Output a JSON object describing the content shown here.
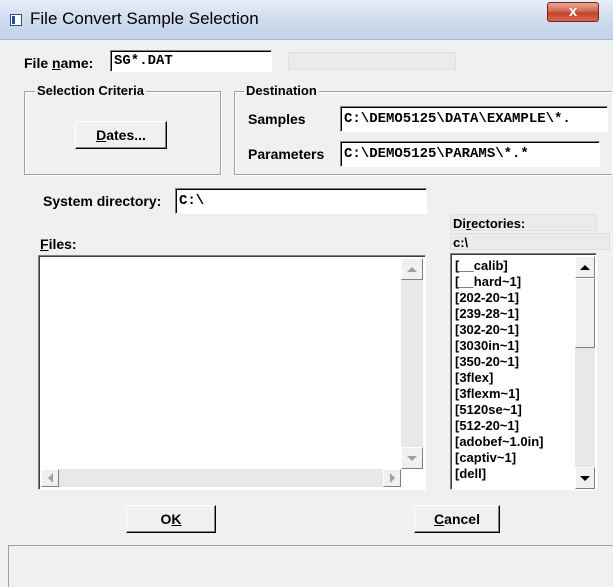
{
  "window": {
    "title": "File Convert Sample Selection",
    "close_label": "x"
  },
  "filename": {
    "label_pre": "File ",
    "label_accel": "n",
    "label_post": "ame:",
    "value": "SG*.DAT"
  },
  "selection_criteria": {
    "title": "Selection Criteria",
    "dates_accel": "D",
    "dates_rest": "ates..."
  },
  "destination": {
    "title": "Destination",
    "samples_label": "Samples",
    "samples_value": "C:\\DEMO5125\\DATA\\EXAMPLE\\*.",
    "parameters_label": "Parameters",
    "parameters_value": "C:\\DEMO5125\\PARAMS\\*.*"
  },
  "system_directory": {
    "label": "System directory:",
    "value": "C:\\"
  },
  "files": {
    "label_accel": "F",
    "label_rest": "iles:",
    "items": []
  },
  "directories": {
    "label_pre": "Di",
    "label_accel": "r",
    "label_post": "ectories:",
    "current_path": "c:\\",
    "items": [
      "[__calib]",
      "[__hard~1]",
      "[202-20~1]",
      "[239-28~1]",
      "[302-20~1]",
      "[3030in~1]",
      "[350-20~1]",
      "[3flex]",
      "[3flexm~1]",
      "[5120se~1]",
      "[512-20~1]",
      "[adobef~1.0in]",
      "[captiv~1]",
      "[dell]"
    ]
  },
  "buttons": {
    "ok_pre": "O",
    "ok_accel": "K",
    "cancel_accel": "C",
    "cancel_rest": "ancel"
  }
}
